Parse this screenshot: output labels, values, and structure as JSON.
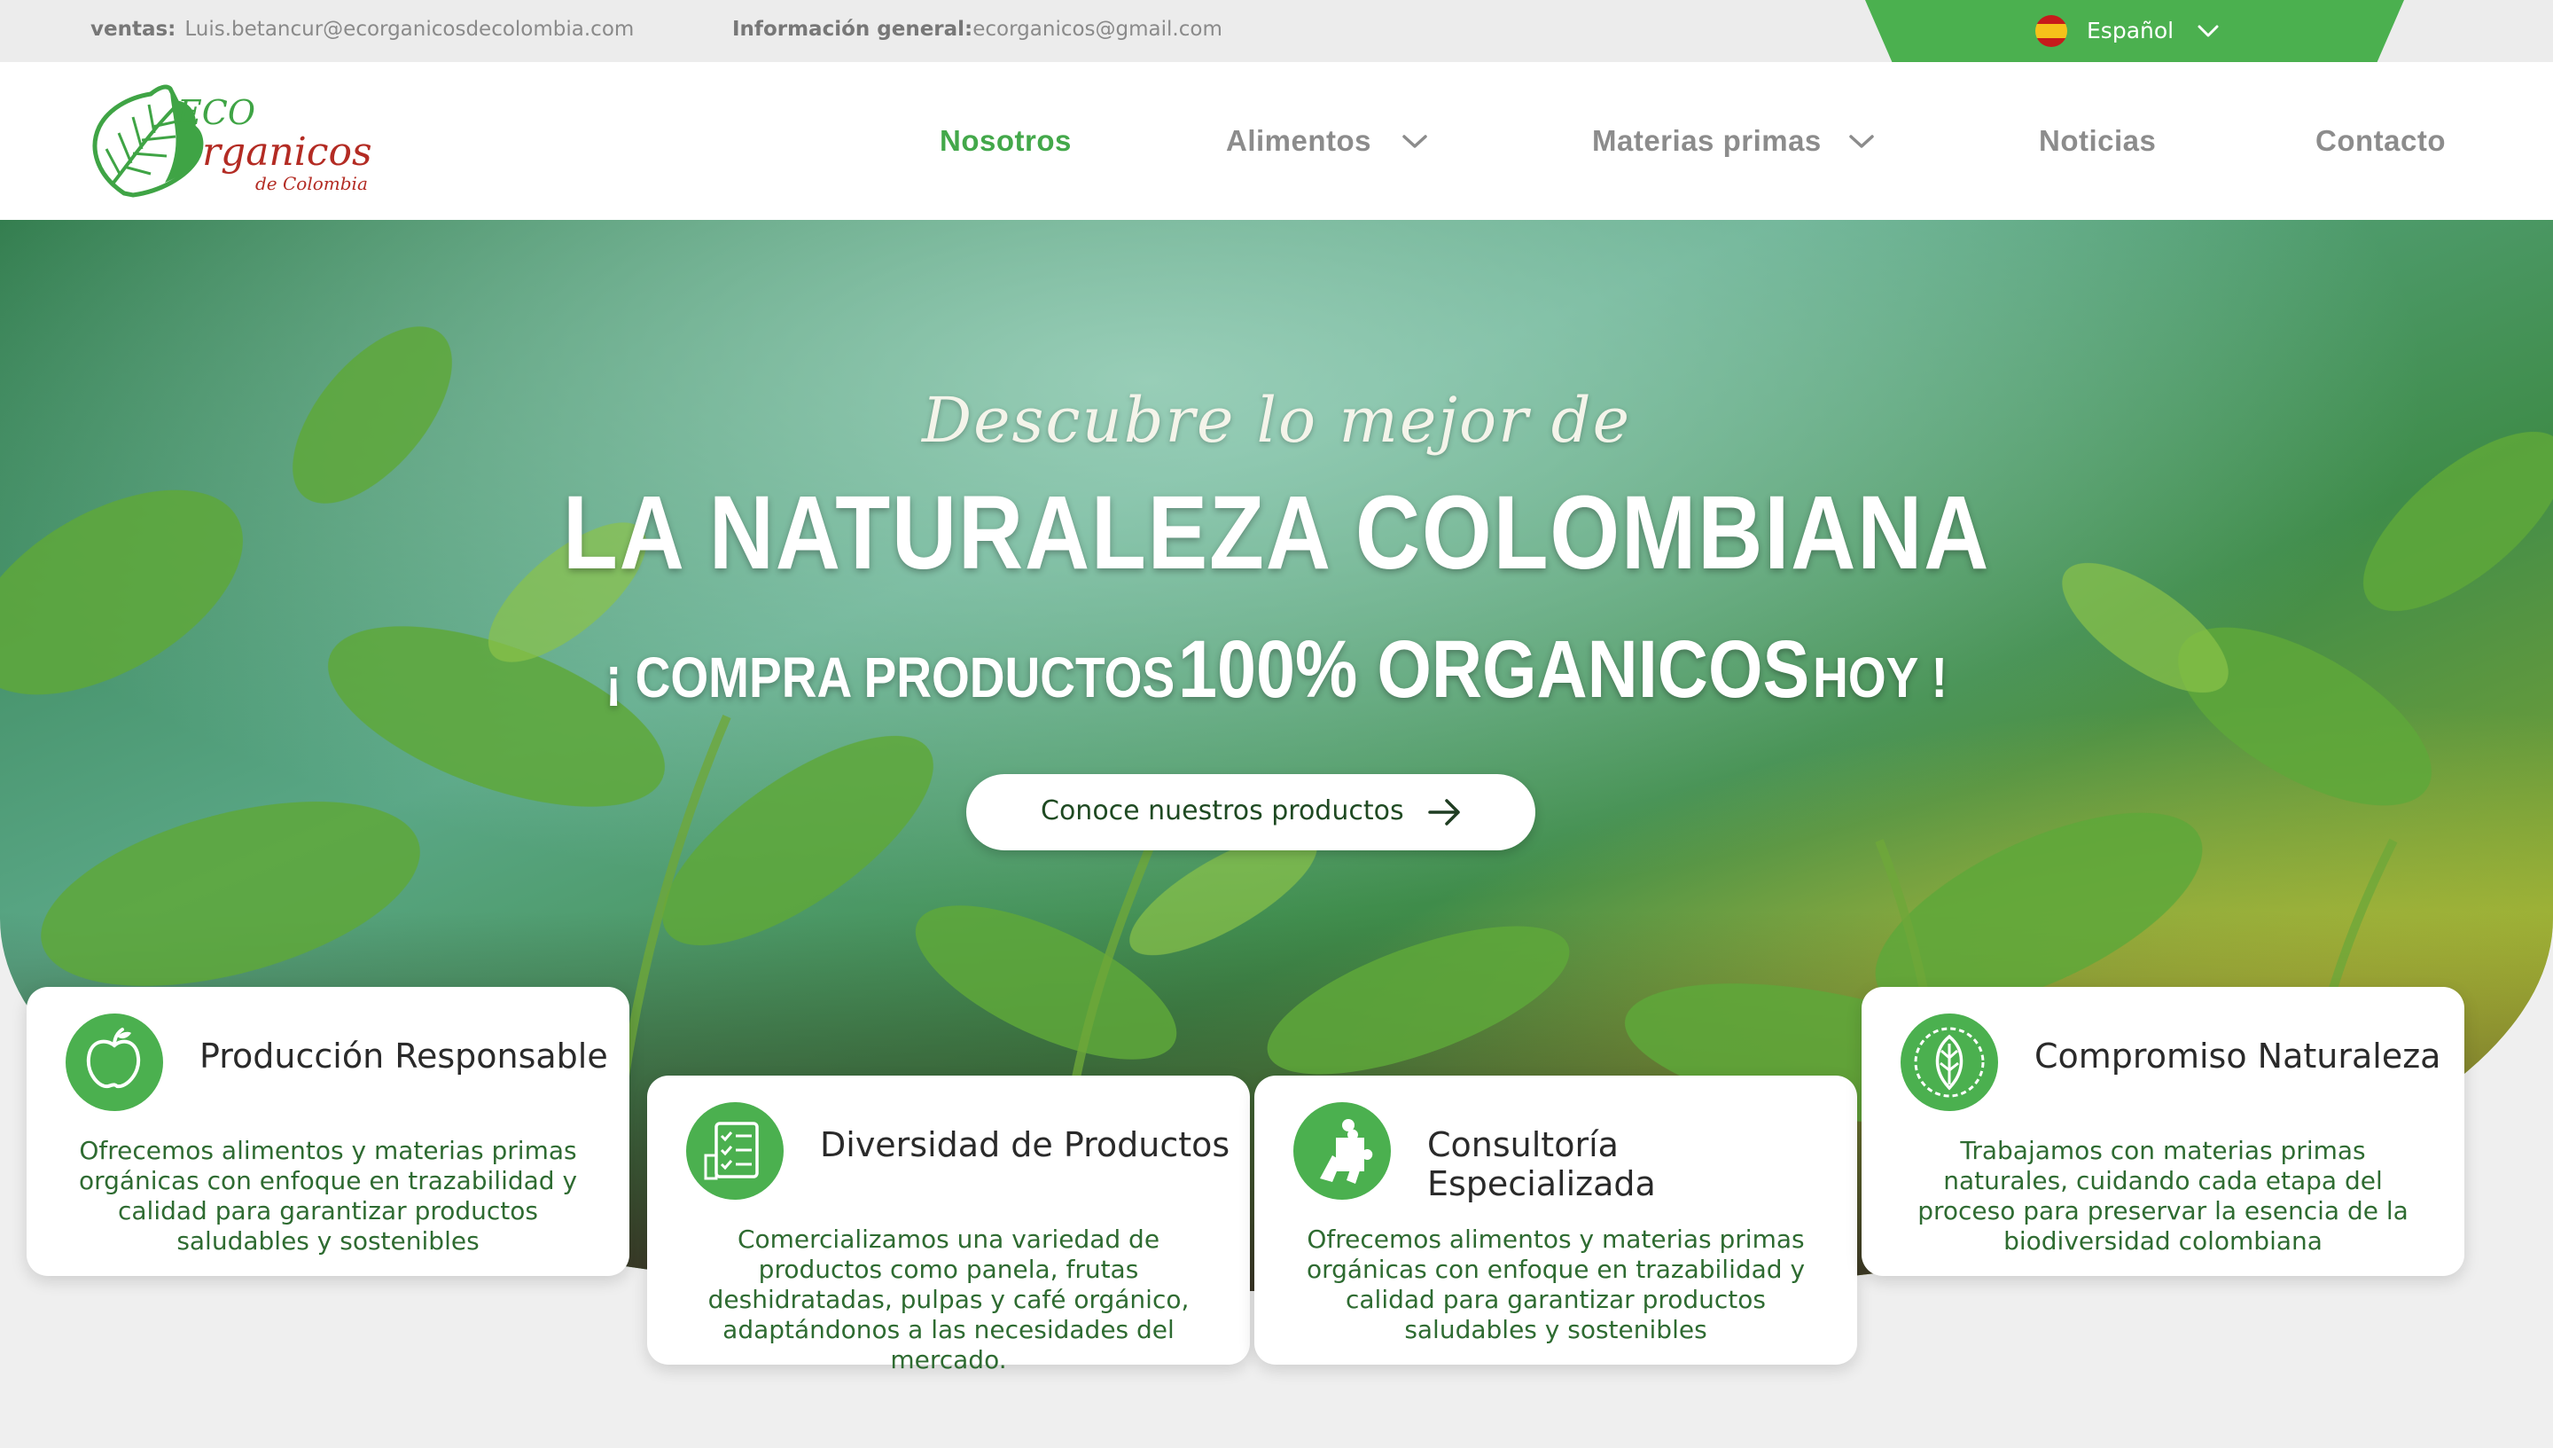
{
  "topbar": {
    "sales_label": "ventas:",
    "sales_email": "Luis.betancur@ecorganicosdecolombia.com",
    "info_label": "Información general:",
    "info_email": "ecorganicos@gmail.com",
    "language": "Español"
  },
  "brand": {
    "logo_line1": "ECO",
    "logo_line2": "rganicos",
    "logo_line3": "de Colombia",
    "accent": "#4bb04f",
    "logo_red": "#b32b23"
  },
  "nav": {
    "items": [
      {
        "label": "Nosotros"
      },
      {
        "label": "Alimentos"
      },
      {
        "label": "Materias primas"
      },
      {
        "label": "Noticias"
      },
      {
        "label": "Contacto"
      }
    ]
  },
  "hero": {
    "script": "Descubre lo mejor de",
    "headline": "LA NATURALEZA COLOMBIANA",
    "sub_pre": "¡ COMPRA PRODUCTOS",
    "sub_big": "100% ORGANICOS",
    "sub_post": "HOY !",
    "cta": "Conoce nuestros productos"
  },
  "cards": [
    {
      "icon": "apple-icon",
      "title": "Producción Responsable",
      "desc": "Ofrecemos alimentos y materias primas orgánicas con enfoque en trazabilidad y calidad para garantizar productos saludables y sostenibles"
    },
    {
      "icon": "checklist-icon",
      "title": "Diversidad de Productos",
      "desc": "Comercializamos una variedad de productos como panela, frutas deshidratadas, pulpas y café orgánico, adaptándonos a las necesidades del mercado."
    },
    {
      "icon": "puzzle-person-icon",
      "title": "Consultoría Especializada",
      "desc": "Ofrecemos alimentos y materias primas orgánicas con enfoque en trazabilidad y calidad para garantizar productos saludables y sostenibles"
    },
    {
      "icon": "leaf-badge-icon",
      "title": "Compromiso Naturaleza",
      "desc": "Trabajamos con materias primas naturales, cuidando cada etapa del proceso para preservar la esencia de la biodiversidad colombiana"
    }
  ]
}
